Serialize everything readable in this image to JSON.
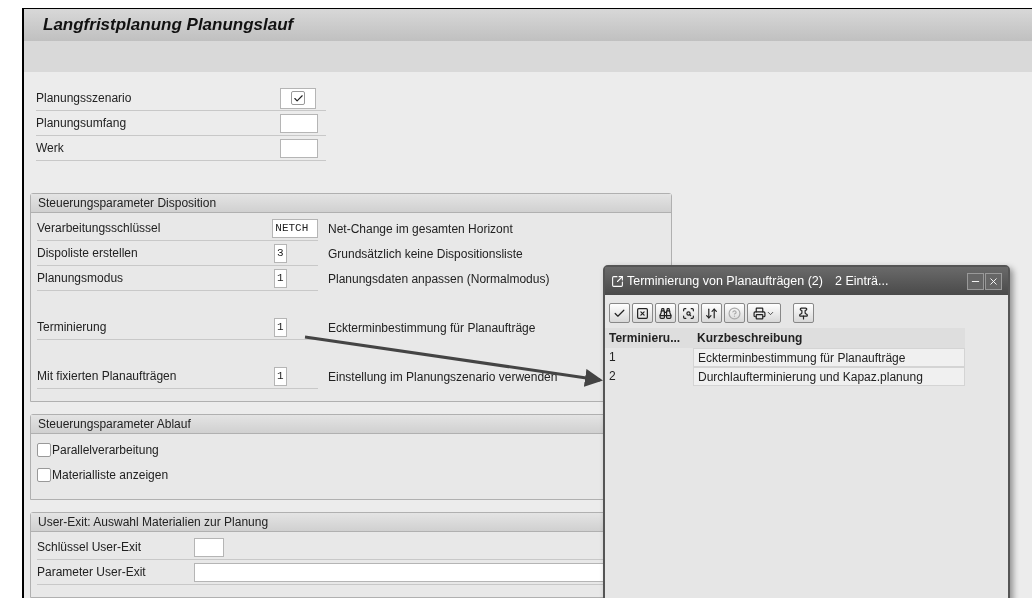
{
  "window": {
    "title": "Langfristplanung Planungslauf"
  },
  "top_fields": [
    {
      "label": "Planungsszenario",
      "kind": "checkbox",
      "checked": true
    },
    {
      "label": "Planungsumfang",
      "kind": "input"
    },
    {
      "label": "Werk",
      "kind": "input"
    }
  ],
  "groups": [
    {
      "title": "Steuerungsparameter Disposition",
      "kind": "params",
      "sections": [
        [
          {
            "label": "Verarbeitungsschlüssel",
            "value": "NETCH",
            "description": "Net-Change im gesamten Horizont"
          },
          {
            "label": "Dispoliste erstellen",
            "value": "3",
            "description": "Grundsätzlich keine Dispositionsliste"
          },
          {
            "label": "Planungsmodus",
            "value": "1",
            "description": "Planungsdaten anpassen (Normalmodus)"
          }
        ],
        [
          {
            "label": "Terminierung",
            "value": "1",
            "description": "Eckterminbestimmung für Planaufträge"
          }
        ],
        [
          {
            "label": "Mit fixierten Planaufträgen",
            "value": "1",
            "description": "Einstellung im Planungszenario verwenden"
          }
        ]
      ]
    },
    {
      "title": "Steuerungsparameter Ablauf",
      "kind": "checks",
      "rows": [
        {
          "label": "Parallelverarbeitung",
          "checked": false
        },
        {
          "label": "Materialliste anzeigen",
          "checked": false
        }
      ]
    },
    {
      "title": "User-Exit: Auswahl Materialien zur Planung",
      "kind": "userexit",
      "rows": [
        {
          "label": "Schlüssel User-Exit",
          "kind": "short-input"
        },
        {
          "label": "Parameter User-Exit",
          "kind": "long-input"
        }
      ]
    }
  ],
  "popup": {
    "title": "Terminierung von Planaufträgen (2)",
    "count": "2 Einträ...",
    "toolbar": [
      {
        "kind": "check",
        "disabled": false
      },
      {
        "kind": "cancel",
        "disabled": false
      },
      {
        "kind": "find",
        "disabled": false
      },
      {
        "kind": "find-next",
        "disabled": false
      },
      {
        "kind": "sort",
        "disabled": false
      },
      {
        "kind": "help",
        "disabled": true
      },
      {
        "kind": "print",
        "disabled": false
      },
      {
        "kind": "pin",
        "disabled": false
      }
    ],
    "columns": [
      "Terminieru...",
      "Kurzbeschreibung"
    ],
    "rows": [
      [
        "1",
        "Eckterminbestimmung für Planaufträge"
      ],
      [
        "2",
        "Durchlaufterminierung und Kapaz.planung"
      ]
    ]
  }
}
